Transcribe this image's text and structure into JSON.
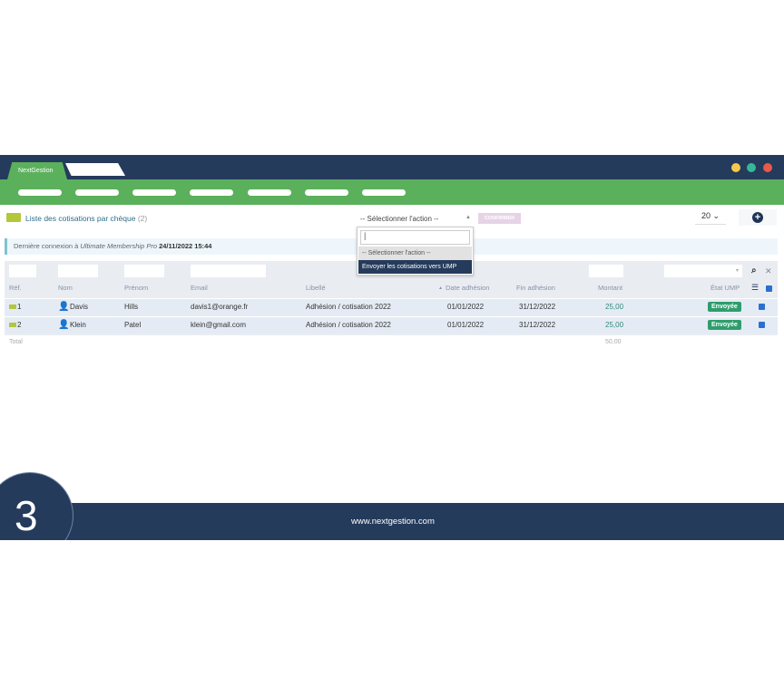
{
  "app": {
    "tab_label": "NextGestion"
  },
  "page": {
    "title": "Liste des cotisations par chèque",
    "count": "(2)"
  },
  "toolbar": {
    "action_select": "-- Sélectionner l'action --",
    "confirm": "CONFIRMER",
    "per_page": "20"
  },
  "dropdown": {
    "search_value": "|",
    "options": [
      "-- Sélectionner l'action --",
      "Envoyer les cotisations vers UMP"
    ]
  },
  "info": {
    "prefix": "Dernière connexion à ",
    "app": "Ultimate Membership Pro",
    "date": "24/11/2022 15:44"
  },
  "table": {
    "headers": [
      "Réf.",
      "Nom",
      "Prénom",
      "Email",
      "Libellé",
      "Date adhésion",
      "Fin adhésion",
      "Montant",
      "État UMP"
    ],
    "rows": [
      {
        "ref": "1",
        "nom": "Davis",
        "prenom": "Hills",
        "email": "davis1@orange.fr",
        "libelle": "Adhésion / cotisation 2022",
        "date": "01/01/2022",
        "fin": "31/12/2022",
        "montant": "25,00",
        "etat": "Envoyée"
      },
      {
        "ref": "2",
        "nom": "Klein",
        "prenom": "Patel",
        "email": "klein@gmail.com",
        "libelle": "Adhésion / cotisation 2022",
        "date": "01/01/2022",
        "fin": "31/12/2022",
        "montant": "25,00",
        "etat": "Envoyée"
      }
    ],
    "total_label": "Total",
    "total": "50,00"
  },
  "footer": {
    "url": "www.nextgestion.com",
    "step": "3"
  },
  "colors": {
    "navy": "#253b5c",
    "green": "#5bb05c",
    "badge": "#2e9d6c"
  }
}
